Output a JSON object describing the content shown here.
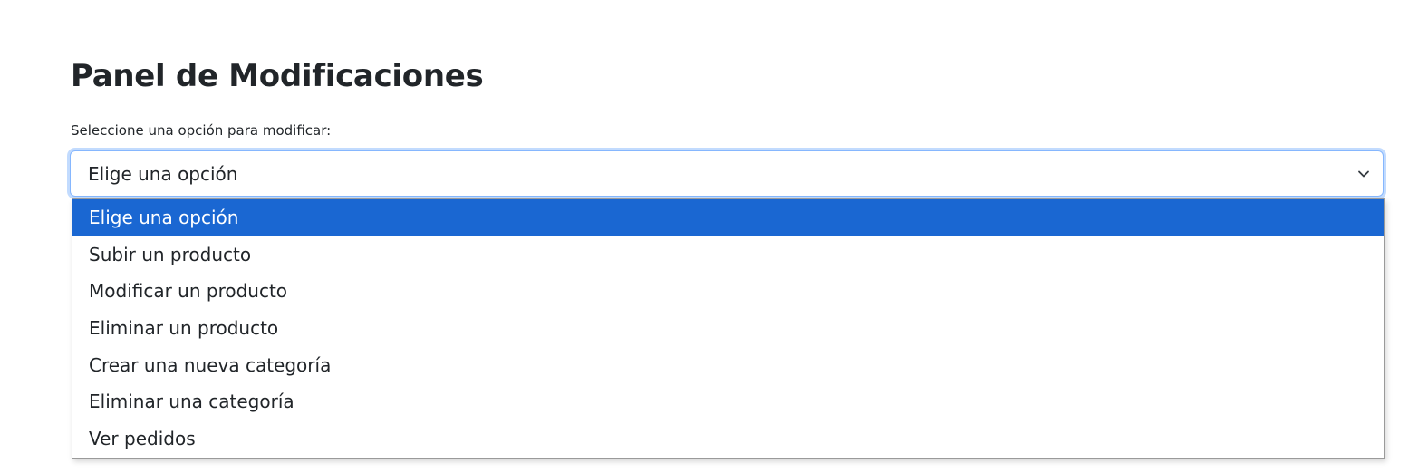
{
  "panel": {
    "title": "Panel de Modificaciones",
    "label": "Seleccione una opción para modificar:"
  },
  "select": {
    "current_value": "Elige una opción",
    "options": [
      "Elige una opción",
      "Subir un producto",
      "Modificar un producto",
      "Eliminar un producto",
      "Crear una nueva categoría",
      "Eliminar una categoría",
      "Ver pedidos"
    ],
    "highlighted_index": 0
  },
  "icons": {
    "dropdown": "chevron-down-icon"
  },
  "colors": {
    "highlight": "#1a67d2",
    "focus_border": "#86b7fe",
    "text": "#212529"
  }
}
